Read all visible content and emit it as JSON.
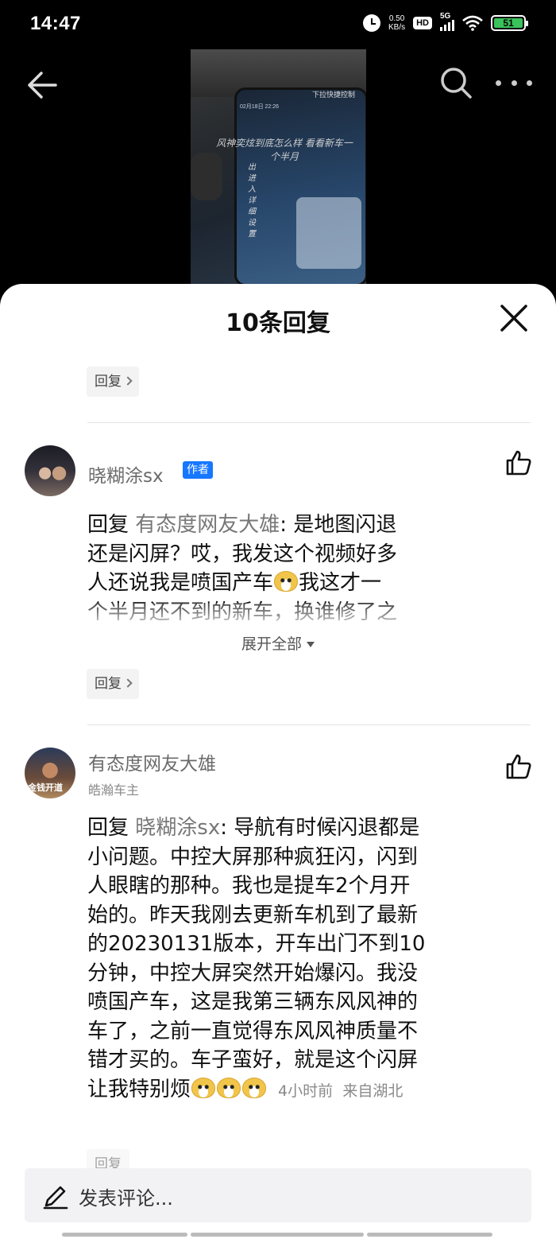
{
  "status_bar": {
    "time": "14:47",
    "net_speed_value": "0.50",
    "net_speed_unit": "KB/s",
    "hd": "HD",
    "network": "5G",
    "battery": "51",
    "icons": [
      "alarm-icon",
      "hd-icon",
      "signal-icon",
      "wifi-icon",
      "battery-icon"
    ]
  },
  "video_header": {
    "icons": [
      "back-arrow-icon",
      "search-icon",
      "more-icon"
    ],
    "thumbnail_caption": "风神奕炫到底怎么样 看看新车一个半月",
    "thumbnail_side_text": "出进入详细设置",
    "thumbnail_corner_text": "下拉快捷控制",
    "thumbnail_screen_text": "02月18日  22:26"
  },
  "sheet": {
    "title": "10条回复",
    "close_icon": "close-icon"
  },
  "reply_label": "回复",
  "comments": [
    {
      "username": "晓糊涂sx",
      "badge": "作者",
      "reply_prefix": "回复",
      "mention": "有态度网友大雄",
      "line1_rest": ": 是地图闪退",
      "line2": "还是闪屏？哎，我发这个视频好多",
      "line3_a": "人还说我是喷国产车",
      "line3_b": "我这才一",
      "line4": "个半月还不到的新车，换谁修了之",
      "expand": "展开全部"
    },
    {
      "username": "有态度网友大雄",
      "subtitle": "皓瀚车主",
      "avatar_text": "金钱开道",
      "reply_prefix": "回复",
      "mention": "晓糊涂sx",
      "line1_rest": ": 导航有时候闪退都是",
      "line2": "小问题。中控大屏那种疯狂闪，闪到",
      "line3": "人眼瞎的那种。我也是提车2个月开",
      "line4": "始的。昨天我刚去更新车机到了最新",
      "line5": "的20230131版本，开车出门不到10",
      "line6": "分钟，中控大屏突然开始爆闪。我没",
      "line7": "喷国产车，这是我第三辆东风风神的",
      "line8": "车了，之前一直觉得东风风神质量不",
      "line9": "错才买的。车子蛮好，就是这个闪屏",
      "line10": "让我特别烦",
      "time_ago": "4小时前",
      "location": "来自湖北"
    }
  ],
  "input": {
    "placeholder": "发表评论..."
  },
  "colors": {
    "badge_blue": "#1677ff",
    "battery_green": "#39c35a"
  }
}
